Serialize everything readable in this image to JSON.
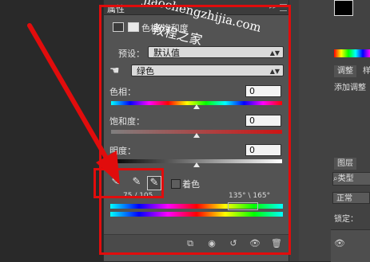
{
  "watermark": {
    "line1": "jiaochengzhijia.com",
    "line2": "教程之家"
  },
  "properties_panel": {
    "title": "属性",
    "collapse_glyph": "»",
    "layer_name": "色相/饱和度",
    "preset_label": "预设：",
    "preset_value": "默认值",
    "channel_value": "绿色",
    "hue_label": "色相：",
    "hue_value": "0",
    "saturation_label": "饱和度：",
    "saturation_value": "0",
    "lightness_label": "明度：",
    "lightness_value": "0",
    "colorize_label": "着色",
    "range_left": "75 / 105",
    "range_right": "135° \\ 165°"
  },
  "right_dock": {
    "adjustments_tab": "调整",
    "styles_tab": "样",
    "add_adjustment": "添加调整",
    "layers_tab": "图层",
    "filter_kind": "类型",
    "blend_mode": "正常",
    "lock_label": "锁定："
  },
  "colors": {
    "highlight_red": "#e10c0c",
    "panel_bg": "#535353",
    "canvas_bg": "#292929"
  }
}
